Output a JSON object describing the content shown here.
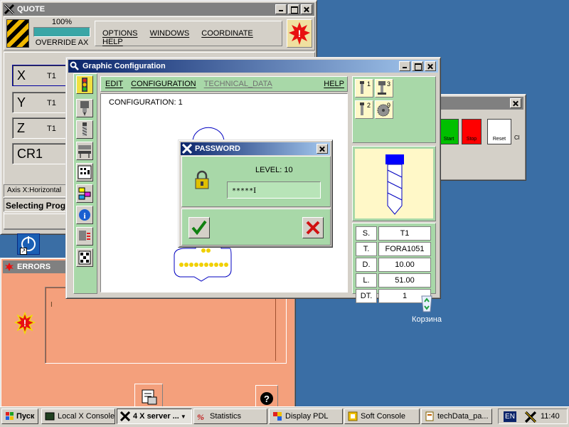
{
  "quote_window": {
    "title": "QUOTE",
    "override_percent_text": "100%",
    "override_fraction": 1.0,
    "override_label": "OVERRIDE AX",
    "menu": [
      "OPTIONS",
      "WINDOWS",
      "COORDINATE",
      "HELP"
    ],
    "axes": [
      {
        "name": "X",
        "tool": "T1"
      },
      {
        "name": "Y",
        "tool": "T1"
      },
      {
        "name": "Z",
        "tool": "T1"
      },
      {
        "name": "CR1",
        "tool": ""
      }
    ],
    "status_line": "Axis X:Horizontal",
    "status_bold": "Selecting Progr"
  },
  "errors_window": {
    "title": "ERRORS"
  },
  "graphic_window": {
    "title": "Graphic Configuration",
    "menu": [
      "EDIT",
      "CONFIGURATION",
      "TECHNICAL_DATA"
    ],
    "help": "HELP",
    "configuration_label": "CONFIGURATION: 1",
    "tool_buttons": [
      "1",
      "3",
      "2",
      "9"
    ],
    "tool_table": [
      {
        "key": "S.",
        "value": "T1"
      },
      {
        "key": "T.",
        "value": "FORA1051"
      },
      {
        "key": "D.",
        "value": "10.00"
      },
      {
        "key": "L.",
        "value": "51.00"
      },
      {
        "key": "DT.",
        "value": "1"
      }
    ]
  },
  "password_dialog": {
    "title": "PASSWORD",
    "level": "LEVEL: 10",
    "value": "*****"
  },
  "back_window": {
    "buttons": [
      "Start",
      "Stop",
      "Reset",
      "Cl"
    ]
  },
  "desktop": {
    "recycle_bin_label": "Корзина"
  },
  "taskbar": {
    "start_label": "Пуск",
    "items": [
      {
        "label": "Local X Console",
        "active": false
      },
      {
        "label": "4 X server ...",
        "active": true
      },
      {
        "label": "Statistics",
        "active": false
      },
      {
        "label": "Display PDL",
        "active": false
      },
      {
        "label": "Soft Console",
        "active": false
      },
      {
        "label": "techData_pa...",
        "active": false
      }
    ],
    "language": "EN",
    "clock": "11:40"
  },
  "colors": {
    "desktop": "#3a6ea5",
    "titlebar_active": "#0a246a",
    "titlebar_inactive": "#808080",
    "panel_green": "#a8d8a8",
    "errors_salmon": "#f4a07c",
    "tool_yellow": "#fff8c8"
  }
}
